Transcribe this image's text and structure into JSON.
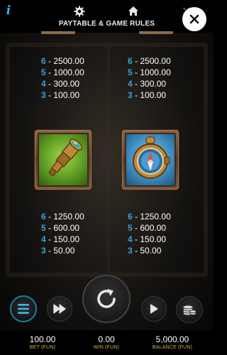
{
  "header": {
    "title": "PAYTABLE & GAME RULES"
  },
  "paytable": [
    {
      "symbol": "jackpot-symbol-left",
      "payouts": [
        {
          "count": "6",
          "amount": "2500.00"
        },
        {
          "count": "5",
          "amount": "1000.00"
        },
        {
          "count": "4",
          "amount": "300.00"
        },
        {
          "count": "3",
          "amount": "100.00"
        }
      ]
    },
    {
      "symbol": "jackpot-symbol-right",
      "payouts": [
        {
          "count": "6",
          "amount": "2500.00"
        },
        {
          "count": "5",
          "amount": "1000.00"
        },
        {
          "count": "4",
          "amount": "300.00"
        },
        {
          "count": "3",
          "amount": "100.00"
        }
      ]
    },
    {
      "symbol": "spyglass-icon",
      "payouts": [
        {
          "count": "6",
          "amount": "1250.00"
        },
        {
          "count": "5",
          "amount": "600.00"
        },
        {
          "count": "4",
          "amount": "150.00"
        },
        {
          "count": "3",
          "amount": "50.00"
        }
      ]
    },
    {
      "symbol": "compass-icon",
      "payouts": [
        {
          "count": "6",
          "amount": "1250.00"
        },
        {
          "count": "5",
          "amount": "600.00"
        },
        {
          "count": "4",
          "amount": "150.00"
        },
        {
          "count": "3",
          "amount": "50.00"
        }
      ]
    }
  ],
  "status": {
    "bet_value": "100.00",
    "bet_label": "BET (FUN)",
    "win_value": "0.00",
    "win_label": "WIN (FUN)",
    "balance_value": "5,000.00",
    "balance_label": "BALANCE (FUN)"
  },
  "colors": {
    "count_blue": "#3aa0e0",
    "label_gold": "#d4b43a",
    "info_blue": "#4aa8e8",
    "menu_ring": "#1c7ea3"
  }
}
